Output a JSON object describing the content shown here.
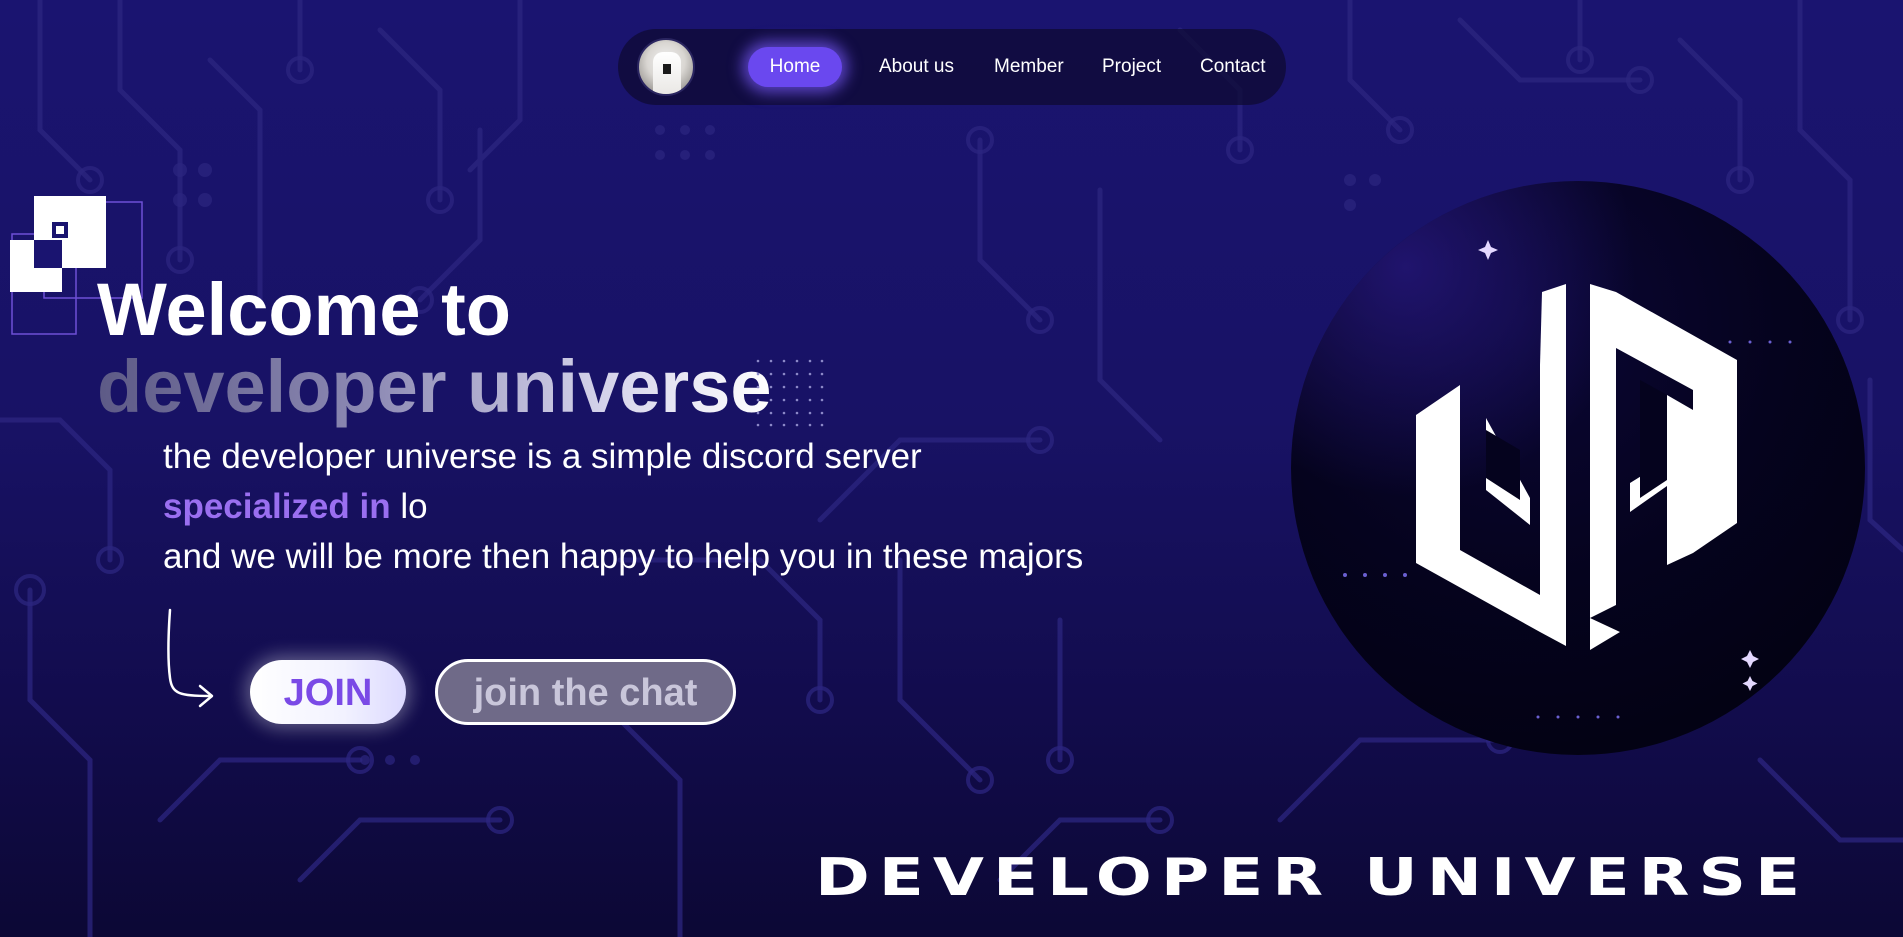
{
  "nav": {
    "items": [
      {
        "label": "Home",
        "active": true
      },
      {
        "label": "About us"
      },
      {
        "label": "Member"
      },
      {
        "label": "Project"
      },
      {
        "label": "Contact"
      }
    ]
  },
  "hero": {
    "title_line1": "Welcome to",
    "title_line2": "developer universe",
    "description": {
      "line1": "the developer universe is a simple discord server",
      "line2_highlight": "specialized in",
      "line2_rest": " lo",
      "line3": "and we will be more then happy to help you in these majors"
    },
    "join_label": "JOIN",
    "chat_label": "join the chat"
  },
  "brand": {
    "wordmark": "DEVELOPER UNIVERSE"
  },
  "colors": {
    "accent": "#6a48ef",
    "highlight": "#9a6ff0",
    "background": "#1a1470"
  },
  "icons": {
    "pixel_logo": "pixel-blocks-icon",
    "arrow": "curved-arrow-icon",
    "brand_logo": "dnu-monogram-icon"
  }
}
